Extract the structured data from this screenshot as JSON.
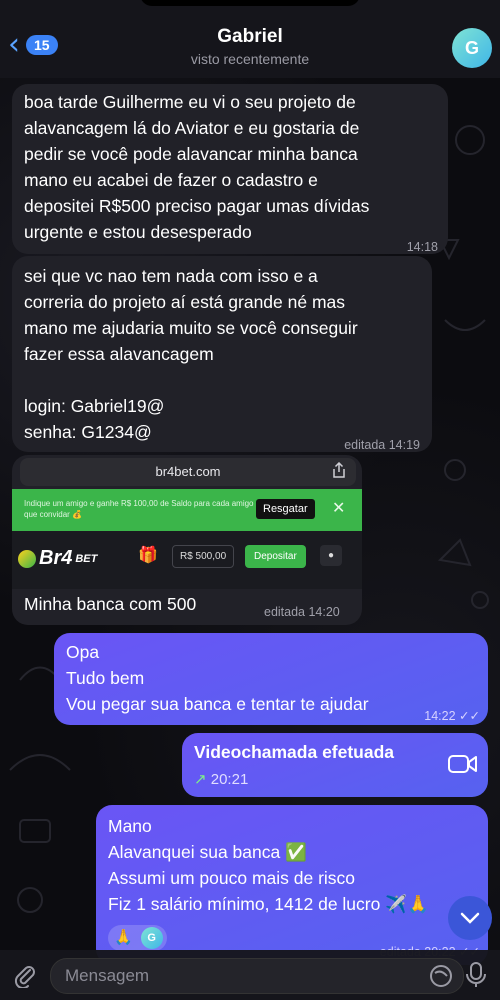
{
  "header": {
    "back_count": "15",
    "name": "Gabriel",
    "status": "visto recentemente",
    "avatar_letter": "G"
  },
  "messages": [
    {
      "text": "boa tarde Guilherme eu vi o seu projeto de\nalavancagem lá do Aviator e eu gostaria de\npedir se você pode alavancar minha banca\nmano eu acabei de fazer o cadastro e\ndepositei R$500 preciso pagar umas dívidas\nurgente e estou desesperado",
      "time": "14:18"
    },
    {
      "text": "sei que vc nao tem nada com isso e a\ncorreria do projeto aí está grande né mas\nmano me ajudaria muito se você conseguir\nfazer essa alavancagem\n\nlogin: Gabriel19@\nsenha: G1234@",
      "time": "editada 14:19"
    }
  ],
  "screenshot": {
    "url": "br4bet.com",
    "promo_text": "Indique um amigo e ganhe R$ 100,00 de Saldo para cada amigo que convidar 💰",
    "resgatar": "Resgatar",
    "logo_text": "Br4",
    "logo_small": "BET",
    "balance": "R$ 500,00",
    "depositar": "Depositar",
    "caption": "Minha banca com 500",
    "time": "editada 14:20"
  },
  "out1": {
    "text": "Opa\nTudo bem\nVou pegar sua banca e tentar te ajudar",
    "time": "14:22"
  },
  "call": {
    "title": "Videochamada efetuada",
    "time": "20:21"
  },
  "out2": {
    "text": "Mano\nAlavanquei sua banca ✅\nAssumi um pouco mais de risco\nFiz 1 salário mínimo, 1412 de lucro ✈️🙏",
    "time": "editada 20:22",
    "reaction_emoji": "🙏",
    "reaction_avatar": "G"
  },
  "input": {
    "placeholder": "Mensagem"
  },
  "colors": {
    "outgoing": "#5e5cf2",
    "incoming": "#212128",
    "accent": "#3b82f6",
    "site_green": "#3bb54a"
  }
}
